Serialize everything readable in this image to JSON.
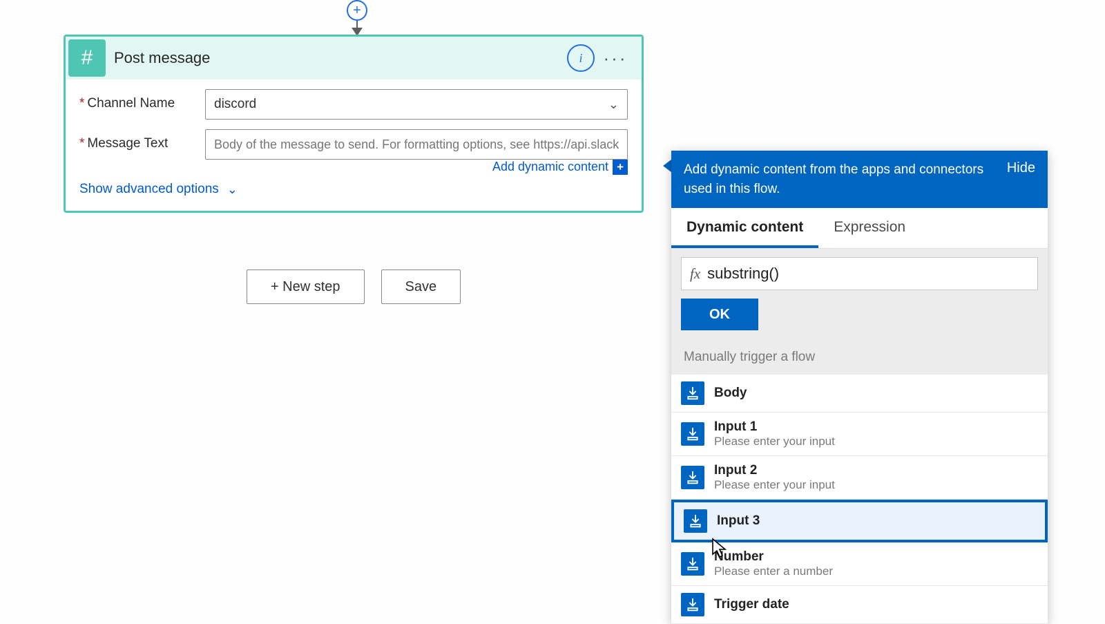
{
  "connector": {
    "plus_label": "+"
  },
  "card": {
    "title": "Post message",
    "icon_glyph": "#",
    "fields": {
      "channel": {
        "label": "Channel Name",
        "required_mark": "*",
        "value": "discord"
      },
      "message": {
        "label": "Message Text",
        "required_mark": "*",
        "placeholder": "Body of the message to send. For formatting options, see https://api.slack.com,"
      }
    },
    "add_dynamic_content": "Add dynamic content",
    "add_dynamic_badge": "+",
    "show_advanced": "Show advanced options"
  },
  "bottom": {
    "new_step": "+ New step",
    "save": "Save"
  },
  "panel": {
    "header": "Add dynamic content from the apps and connectors used in this flow.",
    "hide": "Hide",
    "tabs": {
      "dynamic": "Dynamic content",
      "expression": "Expression"
    },
    "fx_label": "fx",
    "expr_value": "substring()",
    "ok": "OK",
    "group": "Manually trigger a flow",
    "items": [
      {
        "title": "Body",
        "desc": ""
      },
      {
        "title": "Input 1",
        "desc": "Please enter your input"
      },
      {
        "title": "Input 2",
        "desc": "Please enter your input"
      },
      {
        "title": "Input 3",
        "desc": ""
      },
      {
        "title": "Number",
        "desc": "Please enter a number"
      },
      {
        "title": "Trigger date",
        "desc": ""
      }
    ],
    "selected_index": 3
  }
}
